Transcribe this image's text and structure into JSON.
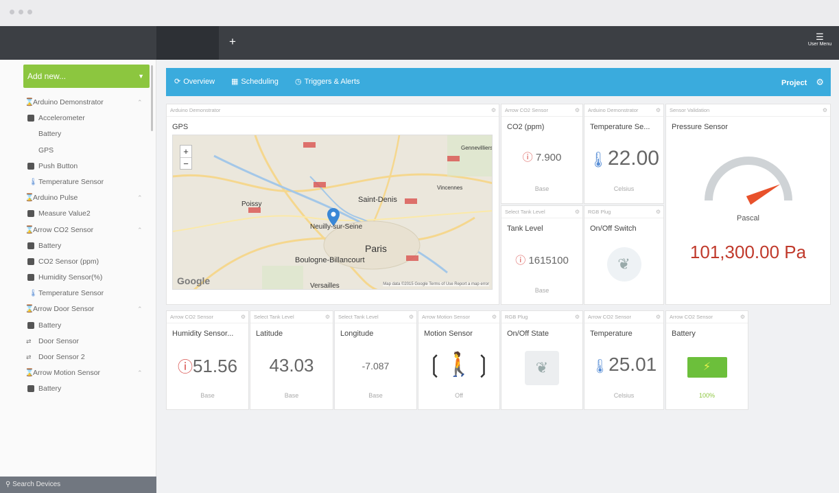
{
  "header": {
    "add_tab": "+",
    "user_menu_label": "User Menu"
  },
  "sidebar": {
    "add_new_label": "Add new...",
    "search_placeholder": "Search Devices",
    "items": [
      {
        "label": "Arduino Demonstrator",
        "type": "group"
      },
      {
        "label": "Accelerometer",
        "type": "child"
      },
      {
        "label": "Battery",
        "type": "child-plain"
      },
      {
        "label": "GPS",
        "type": "child-plain"
      },
      {
        "label": "Push Button",
        "type": "child"
      },
      {
        "label": "Temperature Sensor",
        "type": "child-therm"
      },
      {
        "label": "Arduino Pulse",
        "type": "group"
      },
      {
        "label": "Measure Value2",
        "type": "child"
      },
      {
        "label": "Arrow CO2 Sensor",
        "type": "group"
      },
      {
        "label": "Battery",
        "type": "child"
      },
      {
        "label": "CO2 Sensor (ppm)",
        "type": "child"
      },
      {
        "label": "Humidity Sensor(%)",
        "type": "child"
      },
      {
        "label": "Temperature Sensor",
        "type": "child-therm"
      },
      {
        "label": "Arrow Door Sensor",
        "type": "group"
      },
      {
        "label": "Battery",
        "type": "child"
      },
      {
        "label": "Door Sensor",
        "type": "child-door"
      },
      {
        "label": "Door Sensor 2",
        "type": "child-door"
      },
      {
        "label": "Arrow Motion Sensor",
        "type": "group"
      },
      {
        "label": "Battery",
        "type": "child"
      }
    ]
  },
  "toolbar": {
    "overview": "Overview",
    "scheduling": "Scheduling",
    "triggers": "Triggers & Alerts",
    "project": "Project"
  },
  "widgets": {
    "gps": {
      "source": "Arduino Demonstrator",
      "title": "GPS",
      "places": [
        "Saint-Denis",
        "Neuilly-sur-Seine",
        "Paris",
        "Boulogne-Billancourt",
        "Versailles",
        "Poissy",
        "Gennevilliers",
        "Vincennes"
      ],
      "map_credit": "Map data ©2015 Google   Terms of Use   Report a map error",
      "logo": "Google"
    },
    "co2": {
      "source": "Arrow CO2 Sensor",
      "title": "CO2 (ppm)",
      "value": "7.900",
      "unit": "Base"
    },
    "temp1": {
      "source": "Arduino Demonstrator",
      "title": "Temperature Se...",
      "value": "22.00",
      "unit": "Celsius"
    },
    "pressure": {
      "source": "Sensor Validation",
      "title": "Pressure Sensor",
      "gauge_unit": "Pascal",
      "value": "101,300.00 Pa",
      "level": 0.85
    },
    "tank": {
      "source": "Select Tank Level",
      "title": "Tank Level",
      "value": "1615100",
      "unit": "Base"
    },
    "rgb_switch": {
      "source": "RGB Plug",
      "title": "On/Off Switch"
    },
    "humidity": {
      "source": "Arrow CO2 Sensor",
      "title": "Humidity Sensor...",
      "value": "51.56",
      "unit": "Base"
    },
    "latitude": {
      "source": "Select Tank Level",
      "title": "Latitude",
      "value": "43.03",
      "unit": "Base"
    },
    "longitude": {
      "source": "Select Tank Level",
      "title": "Longitude",
      "value": "-7.087",
      "unit": "Base"
    },
    "motion": {
      "source": "Arrow Motion Sensor",
      "title": "Motion Sensor",
      "state": "Off"
    },
    "rgb_state": {
      "source": "RGB Plug",
      "title": "On/Off State"
    },
    "temp2": {
      "source": "Arrow CO2 Sensor",
      "title": "Temperature",
      "value": "25.01",
      "unit": "Celsius"
    },
    "battery": {
      "source": "Arrow CO2 Sensor",
      "title": "Battery",
      "value": "100%"
    }
  },
  "colors": {
    "accent_green": "#8cc63f",
    "toolbar_blue": "#3aabdd",
    "alert_red": "#d9534f",
    "value_red": "#c0392b",
    "gauge_orange": "#e8512b"
  }
}
